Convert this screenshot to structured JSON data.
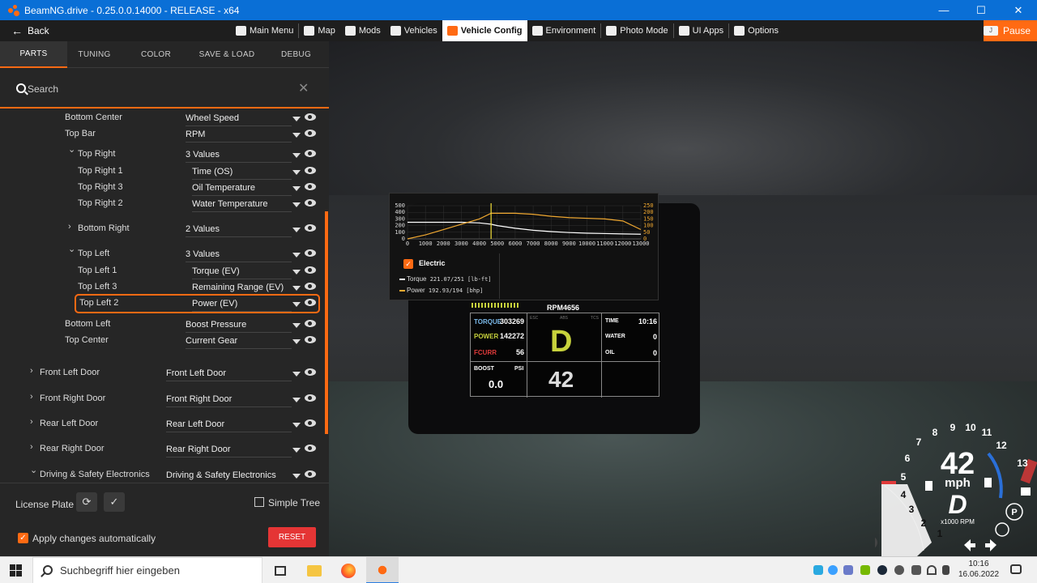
{
  "window": {
    "title": "BeamNG.drive - 0.25.0.0.14000 - RELEASE - x64",
    "controls": [
      "—",
      "☐",
      "✕"
    ]
  },
  "menubar": {
    "back_label": "Back",
    "items": [
      {
        "label": "Main Menu",
        "icon": "grid-icon"
      },
      {
        "label": "Map",
        "icon": "map-icon"
      },
      {
        "label": "Mods",
        "icon": "puzzle-icon"
      },
      {
        "label": "Vehicles",
        "icon": "car-icon"
      },
      {
        "label": "Vehicle Config",
        "icon": "engine-icon",
        "active": true
      },
      {
        "label": "Environment",
        "icon": "weather-icon"
      },
      {
        "label": "Photo Mode",
        "icon": "camera-icon"
      },
      {
        "label": "UI Apps",
        "icon": "apps-icon"
      },
      {
        "label": "Options",
        "icon": "sliders-icon"
      }
    ],
    "pause_key": "J",
    "pause_label": "Pause",
    "accent_color": "#ff6a13"
  },
  "tabs": [
    "PARTS",
    "TUNING",
    "COLOR",
    "SAVE & LOAD",
    "DEBUG"
  ],
  "search": {
    "placeholder": "Search",
    "clear": "✕"
  },
  "tree": [
    {
      "label": "Bottom Center",
      "value": "Wheel Speed"
    },
    {
      "label": "Top Bar",
      "value": "RPM"
    },
    {
      "label": "Top Right",
      "value": "3 Values",
      "chevron": "down"
    },
    {
      "label": "Top Right 1",
      "value": "Time (OS)"
    },
    {
      "label": "Top Right 3",
      "value": "Oil Temperature"
    },
    {
      "label": "Top Right 2",
      "value": "Water Temperature"
    },
    {
      "label": "Bottom Right",
      "value": "2 Values",
      "chevron": "right"
    },
    {
      "label": "Top Left",
      "value": "3 Values",
      "chevron": "down"
    },
    {
      "label": "Top Left 1",
      "value": "Torque (EV)"
    },
    {
      "label": "Top Left 3",
      "value": "Remaining Range (EV)"
    },
    {
      "label": "Top Left 2",
      "value": "Power (EV)",
      "highlighted": true
    },
    {
      "label": "Bottom Left",
      "value": "Boost Pressure"
    },
    {
      "label": "Top Center",
      "value": "Current Gear"
    },
    {
      "label": "Front Left Door",
      "value": "Front Left Door",
      "chevron": "right"
    },
    {
      "label": "Front Right Door",
      "value": "Front Right Door",
      "chevron": "right"
    },
    {
      "label": "Rear Left Door",
      "value": "Rear Left Door",
      "chevron": "right"
    },
    {
      "label": "Rear Right Door",
      "value": "Rear Right Door",
      "chevron": "right"
    },
    {
      "label": "Driving & Safety Electronics",
      "value": "Driving & Safety Electronics",
      "chevron": "down"
    }
  ],
  "footer": {
    "license_plate": "License Plate",
    "refresh_icon": "⟳",
    "apply_icon": "✓",
    "simple_tree": "Simple Tree",
    "apply_auto": "Apply changes automatically",
    "reset": "RESET"
  },
  "chart_data": {
    "type": "line",
    "x": [
      0,
      1000,
      2000,
      3000,
      4000,
      4656,
      5000,
      6000,
      7000,
      8000,
      9000,
      10000,
      11000,
      12000,
      13000
    ],
    "xlim": [
      0,
      13000
    ],
    "xticks": [
      "0",
      "1000",
      "2000",
      "3000",
      "4000",
      "5000",
      "6000",
      "7000",
      "8000",
      "9000",
      "10000",
      "11000",
      "12000",
      "13000"
    ],
    "ylim_left": [
      0,
      500
    ],
    "yticks_left": [
      "500",
      "400",
      "300",
      "200",
      "100",
      "0"
    ],
    "ylim_right": [
      0,
      250
    ],
    "yticks_right": [
      "250",
      "200",
      "150",
      "100",
      "50",
      "0"
    ],
    "series": [
      {
        "name": "Torque",
        "axis": "left",
        "color": "#ffffff",
        "values": [
          250,
          250,
          250,
          250,
          240,
          221,
          200,
          160,
          130,
          110,
          95,
          85,
          80,
          75,
          70
        ]
      },
      {
        "name": "Power",
        "axis": "right",
        "color": "#f0a830",
        "values": [
          0,
          30,
          70,
          110,
          150,
          193,
          193,
          193,
          185,
          170,
          160,
          155,
          150,
          135,
          70
        ]
      }
    ],
    "marker_x": 4656,
    "legend_title": "Electric",
    "legend": [
      {
        "name": "Torque",
        "value": "221.07/251 [lb-ft]"
      },
      {
        "name": "Power",
        "value": "192.93/194 [bhp]"
      }
    ]
  },
  "cluster": {
    "rpm_label": "RPM4656",
    "torque_label": "TORQUE",
    "torque_value": "303269",
    "power_label": "POWER",
    "power_value": "142272",
    "fcurr_label": "FCURR",
    "fcurr_value": "56",
    "esc": "ESC",
    "abs": "ABS",
    "tcs": "TCS",
    "gear": "D",
    "time_label": "TIME",
    "time_value": "10:16",
    "water_label": "WATER",
    "water_value": "0",
    "oil_label": "OIL",
    "oil_value": "0",
    "boost_label": "BOOST",
    "boost_unit": "PSI",
    "boost_value": "0.0",
    "speed": "42"
  },
  "speedo": {
    "ticks": [
      "1",
      "2",
      "3",
      "4",
      "5",
      "6",
      "7",
      "8",
      "9",
      "10",
      "11",
      "12",
      "13"
    ],
    "speed": "42",
    "unit": "mph",
    "gear": "D",
    "rpm_unit": "x1000 RPM"
  },
  "taskbar": {
    "search_placeholder": "Suchbegriff hier eingeben",
    "time": "10:16",
    "date": "16.06.2022"
  }
}
